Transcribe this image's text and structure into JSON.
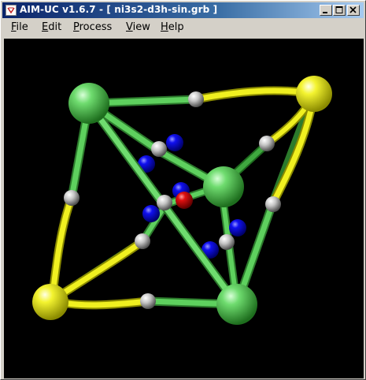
{
  "window": {
    "title": "AIM-UC v1.6.7 - [ ni3s2-d3h-sin.grb ]"
  },
  "menu": {
    "items": [
      {
        "key": "F",
        "rest": "ile"
      },
      {
        "key": "E",
        "rest": "dit"
      },
      {
        "key": "P",
        "rest": "rocess"
      },
      {
        "key": "V",
        "rest": "iew"
      },
      {
        "key": "H",
        "rest": "elp"
      }
    ]
  },
  "scene": {
    "background": "#000000",
    "colors": {
      "ni_atom": "#4ec24e",
      "s_atom": "#f0f020",
      "ni_bond": "#4ec24e",
      "s_bond": "#f0f020",
      "bond_cp": "#c8c8c8",
      "ring_cp": "#0000e0",
      "cage_cp": "#e00000"
    }
  }
}
